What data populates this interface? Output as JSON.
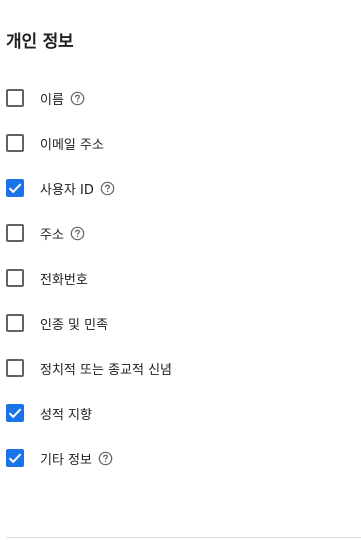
{
  "section": {
    "title": "개인 정보"
  },
  "colors": {
    "checked": "#1a73e8",
    "unchecked_border": "#5f6368",
    "text": "#202124"
  },
  "options": [
    {
      "label": "이름",
      "checked": false,
      "help_icon": "help-circle-icon"
    },
    {
      "label": "이메일 주소",
      "checked": false,
      "help_icon": null
    },
    {
      "label": "사용자 ID",
      "checked": true,
      "help_icon": "help-circle-icon"
    },
    {
      "label": "주소",
      "checked": false,
      "help_icon": "help-circle-icon"
    },
    {
      "label": "전화번호",
      "checked": false,
      "help_icon": null
    },
    {
      "label": "인종 및 민족",
      "checked": false,
      "help_icon": null
    },
    {
      "label": "정치적 또는 종교적 신념",
      "checked": false,
      "help_icon": null
    },
    {
      "label": "성적 지향",
      "checked": true,
      "help_icon": null
    },
    {
      "label": "기타 정보",
      "checked": true,
      "help_icon": "help-circle-icon"
    }
  ]
}
